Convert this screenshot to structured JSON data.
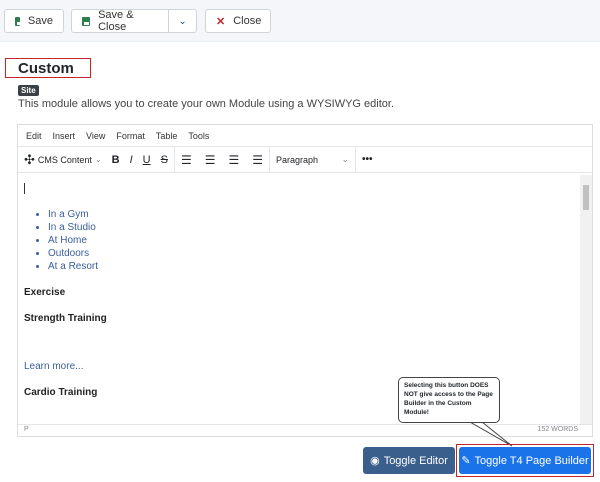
{
  "toolbar": {
    "save": "Save",
    "save_close": "Save & Close",
    "close": "Close"
  },
  "page": {
    "title": "Custom",
    "badge": "Site",
    "description": "This module allows you to create your own Module using a WYSIWYG editor."
  },
  "editor": {
    "menu": [
      "Edit",
      "Insert",
      "View",
      "Format",
      "Table",
      "Tools"
    ],
    "cms_content": "CMS Content",
    "format_select": "Paragraph",
    "list": [
      "In a Gym",
      "In a Studio",
      "At Home",
      "Outdoors",
      "At a Resort"
    ],
    "exercise": "Exercise",
    "strength": "Strength Training",
    "learn_more": "Learn more...",
    "cardio": "Cardio Training",
    "path": "P",
    "word_count": "152 WORDS"
  },
  "actions": {
    "toggle_editor": "Toggle Editor",
    "toggle_t4": "Toggle T4 Page Builder"
  },
  "callout": "Selecting this button DOES NOT give access to the Page Builder in the Custom Module!"
}
